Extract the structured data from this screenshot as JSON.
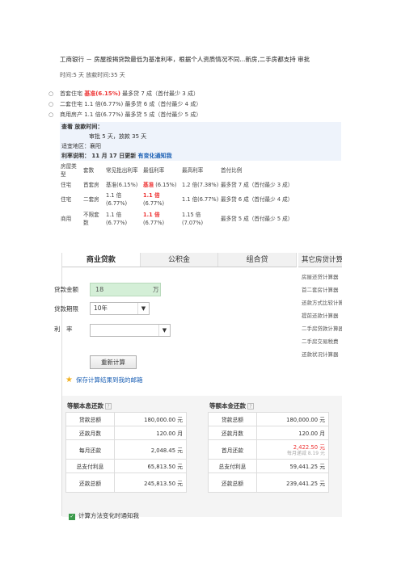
{
  "header": {
    "title": "工商银行 － 房屋按揭贷款最低为基准利率，根据个人资质情况不同...新房,二手房都支持 审批",
    "subtitle": "时间:5 天   放款时间:35 天"
  },
  "bullets": [
    {
      "prefix": "首套住宅 ",
      "highlight": "基准(6.15%)",
      "suffix": " 最多贷 7 成（首付最少 3 成）"
    },
    {
      "prefix": "二套住宅 1.1 倍(6.77%) 最多贷 6 成（首付最少 4 成）",
      "highlight": "",
      "suffix": ""
    },
    {
      "prefix": "商用房产 1.1 倍(6.77%) 最多贷 5 成（首付最少 5 成）",
      "highlight": "",
      "suffix": ""
    }
  ],
  "info": {
    "row1": "查看 放款时间：",
    "row2": "审批 5 天，放款 35 天",
    "region": "适宜地区：襄阳",
    "rate_label": "利率说明： 11 月 17 日更新 ",
    "rate_link": "有变化通知我"
  },
  "rate_table": {
    "headers": [
      "房屋类型",
      "套数",
      "常见批出利率",
      "最低利率",
      "最高利率",
      "首付比例"
    ],
    "rows": [
      {
        "type": "住宅",
        "count": "首套房",
        "common": "基准(6.15%)",
        "min_strong": "基准",
        "min_rest": "(6.15%)",
        "max": "1.2 倍(7.38%)",
        "ratio": "最多贷 7 成（首付最少 3 成）"
      },
      {
        "type": "住宅",
        "count": "二套房",
        "common": "1.1 倍(6.77%)",
        "min_strong": "1.1 倍",
        "min_rest": "(6.77%)",
        "max": "1.1 倍(6.77%)",
        "ratio": "最多贷 6 成（首付最少 4 成）"
      },
      {
        "type": "商用",
        "count": "不限套数",
        "common": "1.1 倍(6.77%)",
        "min_strong": "1.1 倍",
        "min_rest": "(6.77%)",
        "max": "1.15 倍(7.07%)",
        "ratio": "最多贷 5 成（首付最少 5 成）"
      }
    ]
  },
  "calculator": {
    "tabs": [
      "商业贷款",
      "公积金",
      "组合贷"
    ],
    "active_tab": 0,
    "amount_label": "贷款金额",
    "amount_value": "18",
    "amount_unit": "万",
    "term_label": "贷款期限",
    "term_value": "10年",
    "rate_label": "利　率",
    "rate_value": "",
    "recalc_label": "重新计算",
    "save_link": "保存计算结果到我的邮箱",
    "footer_link": "计算方法变化时通知我"
  },
  "sidebar": {
    "title": "其它房贷计算",
    "items": [
      "房屋还贷计算器",
      "首二套房计算器",
      "还款方式比较计算器",
      "提前还款计算器",
      "二手房贷款计算器",
      "二手房交易税费",
      "还款状况计算器"
    ]
  },
  "results": {
    "left": {
      "title": "等额本息还款",
      "rows": [
        {
          "k": "贷款总额",
          "v": "180,000.00 元",
          "red": false
        },
        {
          "k": "还款月数",
          "v": "120.00 月",
          "red": false
        },
        {
          "k": "每月还款",
          "v": "2,048.45 元",
          "red": true
        },
        {
          "k": "总支付利息",
          "v": "65,813.50 元",
          "red": true
        },
        {
          "k": "还款总额",
          "v": "245,813.50 元",
          "red": true
        }
      ]
    },
    "right": {
      "title": "等额本金还款",
      "rows": [
        {
          "k": "贷款总额",
          "v": "180,000.00 元",
          "red": false
        },
        {
          "k": "还款月数",
          "v": "120.00 月",
          "red": false
        },
        {
          "k": "首月还款",
          "v": "2,422.50 元",
          "sub": "每月递减 8.19 元",
          "red": true
        },
        {
          "k": "总支付利息",
          "v": "59,441.25 元",
          "red": true
        },
        {
          "k": "还款总额",
          "v": "239,441.25 元",
          "red": true
        }
      ]
    }
  }
}
